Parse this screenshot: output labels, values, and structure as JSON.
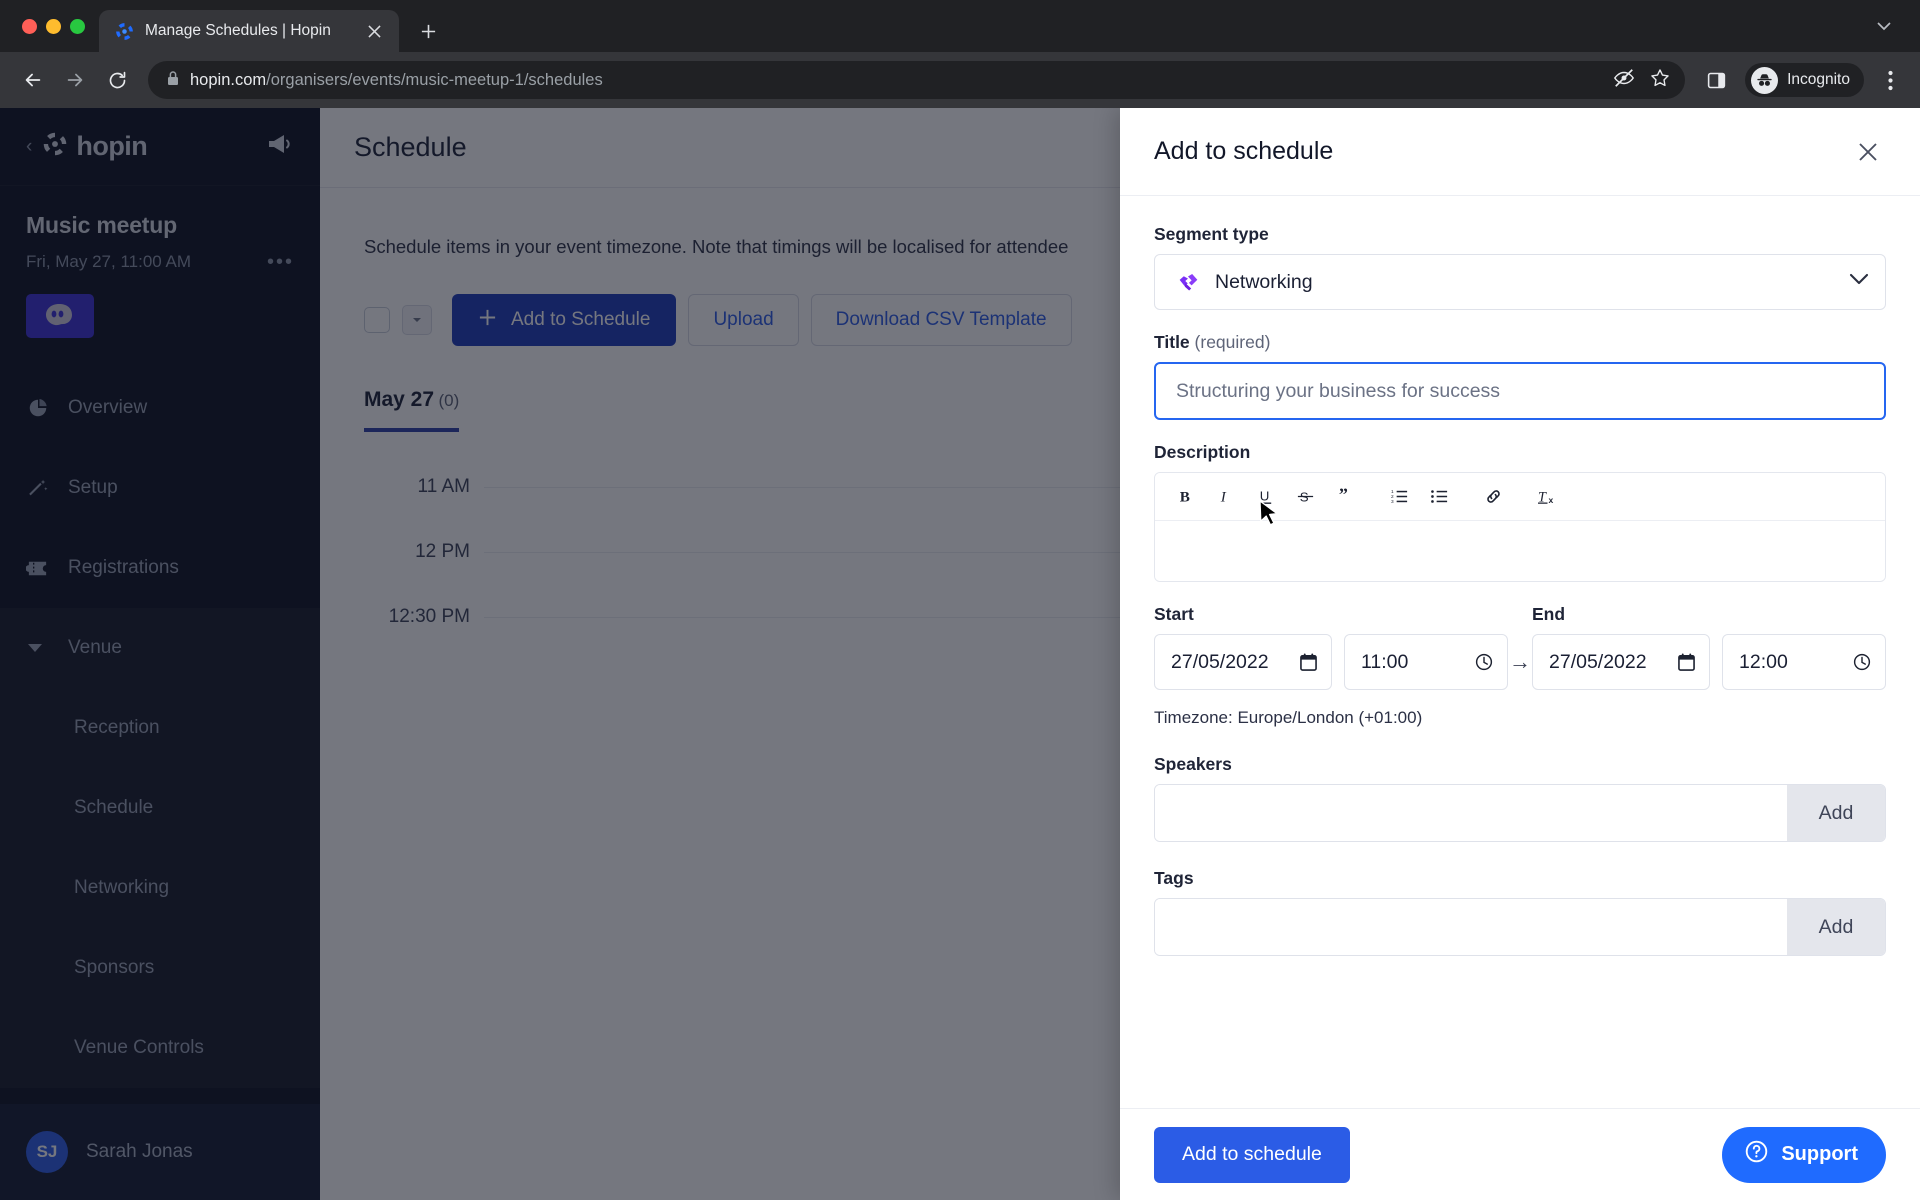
{
  "browser": {
    "tab": {
      "title": "Manage Schedules | Hopin",
      "favicon_icon": "hopin-favicon",
      "close_icon": "close-icon"
    },
    "new_tab_icon": "plus-icon",
    "window_chevron_icon": "chevron-down-icon",
    "nav": {
      "back_icon": "arrow-left-icon",
      "forward_icon": "arrow-right-icon",
      "reload_icon": "reload-icon"
    },
    "omnibox": {
      "lock_icon": "lock-icon",
      "host": "hopin.com",
      "path": "/organisers/events/music-meetup-1/schedules",
      "tracking_icon": "eye-slash-icon",
      "bookmark_icon": "star-icon",
      "sidepanel_icon": "side-panel-icon"
    },
    "profile": {
      "label": "Incognito",
      "icon": "incognito-icon"
    },
    "menu_icon": "kebab-menu-icon"
  },
  "sidebar": {
    "back_icon": "chevron-left-icon",
    "brand": "hopin",
    "brand_icon": "hopin-logo-icon",
    "announce_icon": "megaphone-icon",
    "event": {
      "name": "Music meetup",
      "date": "Fri, May 27, 11:00 AM",
      "more_icon": "ellipsis-icon",
      "thumbnail_icon": "event-thumbnail"
    },
    "items": [
      {
        "label": "Overview",
        "icon": "pie-chart-icon",
        "level": "top"
      },
      {
        "label": "Setup",
        "icon": "magic-wand-icon",
        "level": "top"
      },
      {
        "label": "Registrations",
        "icon": "ticket-icon",
        "level": "top"
      },
      {
        "label": "Venue",
        "icon": "caret-down-icon",
        "level": "group"
      },
      {
        "label": "Reception",
        "icon": "",
        "level": "sub"
      },
      {
        "label": "Schedule",
        "icon": "",
        "level": "sub"
      },
      {
        "label": "Networking",
        "icon": "",
        "level": "sub"
      },
      {
        "label": "Sponsors",
        "icon": "",
        "level": "sub"
      },
      {
        "label": "Venue Controls",
        "icon": "",
        "level": "sub"
      }
    ],
    "user": {
      "initials": "SJ",
      "name": "Sarah Jonas"
    }
  },
  "main": {
    "title": "Schedule",
    "note": "Schedule items in your event timezone. Note that timings will be localised for attendee",
    "toolbar": {
      "select_all_checkbox": "",
      "dropdown_icon": "caret-down-icon",
      "add_label": "Add to Schedule",
      "add_icon": "plus-icon",
      "upload_label": "Upload",
      "download_label": "Download CSV Template"
    },
    "day_tab": {
      "label": "May 27",
      "count": "(0)"
    },
    "times": [
      "11 AM",
      "12 PM",
      "12:30 PM"
    ]
  },
  "panel": {
    "title": "Add to schedule",
    "close_icon": "close-icon",
    "segment_type": {
      "label": "Segment type",
      "value": "Networking",
      "icon": "handshake-icon",
      "icon_color": "#7b2ff7",
      "chevron_icon": "chevron-down-icon"
    },
    "title_field": {
      "label": "Title",
      "required_note": "(required)",
      "value": "Structuring your business for success",
      "placeholder": "Structuring your business for success",
      "focus_color": "#2566f0"
    },
    "description": {
      "label": "Description",
      "content": "",
      "toolbar": [
        {
          "name": "bold-icon",
          "glyph": "B"
        },
        {
          "name": "italic-icon",
          "glyph": "I"
        },
        {
          "name": "underline-icon",
          "glyph": "U"
        },
        {
          "name": "strikethrough-icon",
          "glyph": "S"
        },
        {
          "name": "blockquote-icon",
          "glyph": "”"
        },
        {
          "name": "ordered-list-icon",
          "glyph": "1."
        },
        {
          "name": "bullet-list-icon",
          "glyph": "•"
        },
        {
          "name": "link-icon",
          "glyph": "🔗"
        },
        {
          "name": "clear-formatting-icon",
          "glyph": "Tx"
        }
      ]
    },
    "start": {
      "label": "Start",
      "date": "27/05/2022",
      "time": "11:00",
      "date_icon": "calendar-icon",
      "time_icon": "clock-icon"
    },
    "end": {
      "label": "End",
      "date": "27/05/2022",
      "time": "12:00",
      "date_icon": "calendar-icon",
      "time_icon": "clock-icon"
    },
    "range_arrow_icon": "arrow-right-icon",
    "timezone": "Timezone: Europe/London (+01:00)",
    "speakers": {
      "label": "Speakers",
      "value": "",
      "add_label": "Add"
    },
    "tags": {
      "label": "Tags",
      "value": "",
      "add_label": "Add"
    },
    "submit_label": "Add to schedule"
  },
  "support": {
    "label": "Support",
    "icon": "question-circle-icon"
  }
}
